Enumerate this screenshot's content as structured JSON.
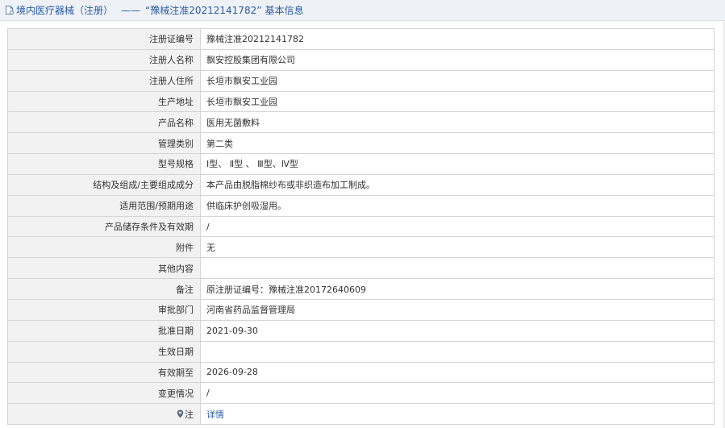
{
  "header": {
    "category": "境内医疗器械（注册）",
    "dash": "——",
    "reg_title": "“豫械注准20212141782”",
    "suffix": "基本信息"
  },
  "rows": [
    {
      "label": "注册证编号",
      "value": "豫械注准20212141782"
    },
    {
      "label": "注册人名称",
      "value": "飘安控股集团有限公司"
    },
    {
      "label": "注册人住所",
      "value": "长垣市飘安工业园"
    },
    {
      "label": "生产地址",
      "value": "长垣市飘安工业园"
    },
    {
      "label": "产品名称",
      "value": "医用无菌敷料"
    },
    {
      "label": "管理类别",
      "value": "第二类"
    },
    {
      "label": "型号规格",
      "value": "Ⅰ型、 Ⅱ型 、 Ⅲ型、Ⅳ型"
    },
    {
      "label": "结构及组成/主要组成成分",
      "value": "本产品由脱脂棉纱布或非织造布加工制成。"
    },
    {
      "label": "适用范围/预期用途",
      "value": "供临床护创吸湿用。"
    },
    {
      "label": "产品储存条件及有效期",
      "value": "/"
    },
    {
      "label": "附件",
      "value": "无"
    },
    {
      "label": "其他内容",
      "value": ""
    },
    {
      "label": "备注",
      "value": "原注册证编号：豫械注准20172640609"
    },
    {
      "label": "审批部门",
      "value": "河南省药品监督管理局"
    },
    {
      "label": "批准日期",
      "value": "2021-09-30"
    },
    {
      "label": "生效日期",
      "value": ""
    },
    {
      "label": "有效期至",
      "value": "2026-09-28"
    },
    {
      "label": "变更情况",
      "value": "/"
    }
  ],
  "note_row": {
    "label": "注",
    "value": "详情"
  },
  "icons": {
    "header": "document-icon",
    "note": "map-pin-icon"
  },
  "colors": {
    "link": "#2b5aa0",
    "label_bg": "#f2f2f2",
    "border": "#d5d5d5",
    "header_bg": "#eef2f7"
  }
}
